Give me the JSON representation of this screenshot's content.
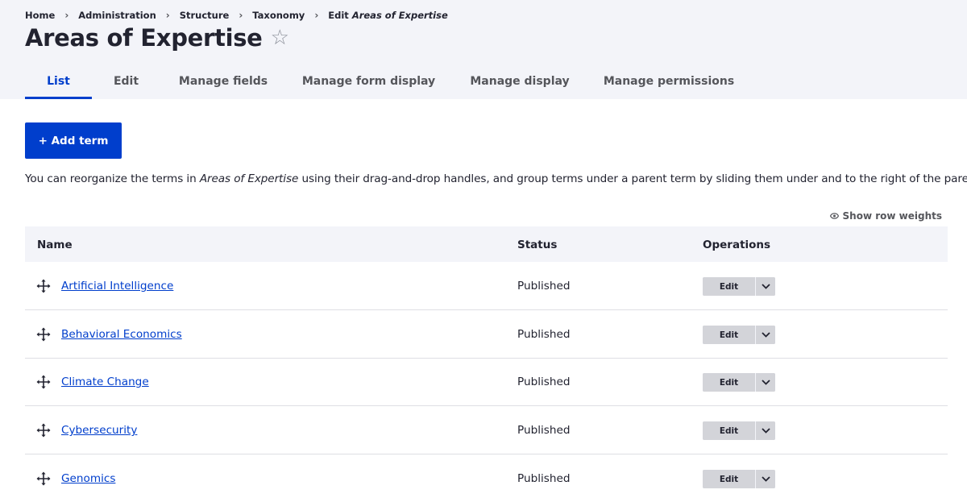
{
  "breadcrumb": {
    "items": [
      "Home",
      "Administration",
      "Structure",
      "Taxonomy"
    ],
    "current_prefix": "Edit",
    "current_em": "Areas of Expertise"
  },
  "page": {
    "title": "Areas of Expertise"
  },
  "tabs": [
    {
      "label": "List",
      "active": true
    },
    {
      "label": "Edit"
    },
    {
      "label": "Manage fields"
    },
    {
      "label": "Manage form display"
    },
    {
      "label": "Manage display"
    },
    {
      "label": "Manage permissions"
    }
  ],
  "actions": {
    "add_term": "+ Add term"
  },
  "help": {
    "before": "You can reorganize the terms in ",
    "em": "Areas of Expertise",
    "after": " using their drag-and-drop handles, and group terms under a parent term by sliding them under and to the right of the parent."
  },
  "table": {
    "show_row_weights": "Show row weights",
    "headers": {
      "name": "Name",
      "status": "Status",
      "operations": "Operations"
    },
    "edit_label": "Edit",
    "rows": [
      {
        "name": "Artificial Intelligence",
        "status": "Published"
      },
      {
        "name": "Behavioral Economics",
        "status": "Published"
      },
      {
        "name": "Climate Change",
        "status": "Published"
      },
      {
        "name": "Cybersecurity",
        "status": "Published"
      },
      {
        "name": "Genomics",
        "status": "Published"
      }
    ]
  },
  "icons": {
    "star": "star-outline-icon",
    "drag": "drag-handle-icon",
    "eye": "eye-icon",
    "chevron": "chevron-down-icon",
    "breadcrumb_sep": "chevron-right-icon"
  },
  "colors": {
    "accent": "#003ecc",
    "header_bg": "#f3f4f9",
    "text": "#222330",
    "muted": "#55565b",
    "ops_bg": "#d3d4d9"
  }
}
